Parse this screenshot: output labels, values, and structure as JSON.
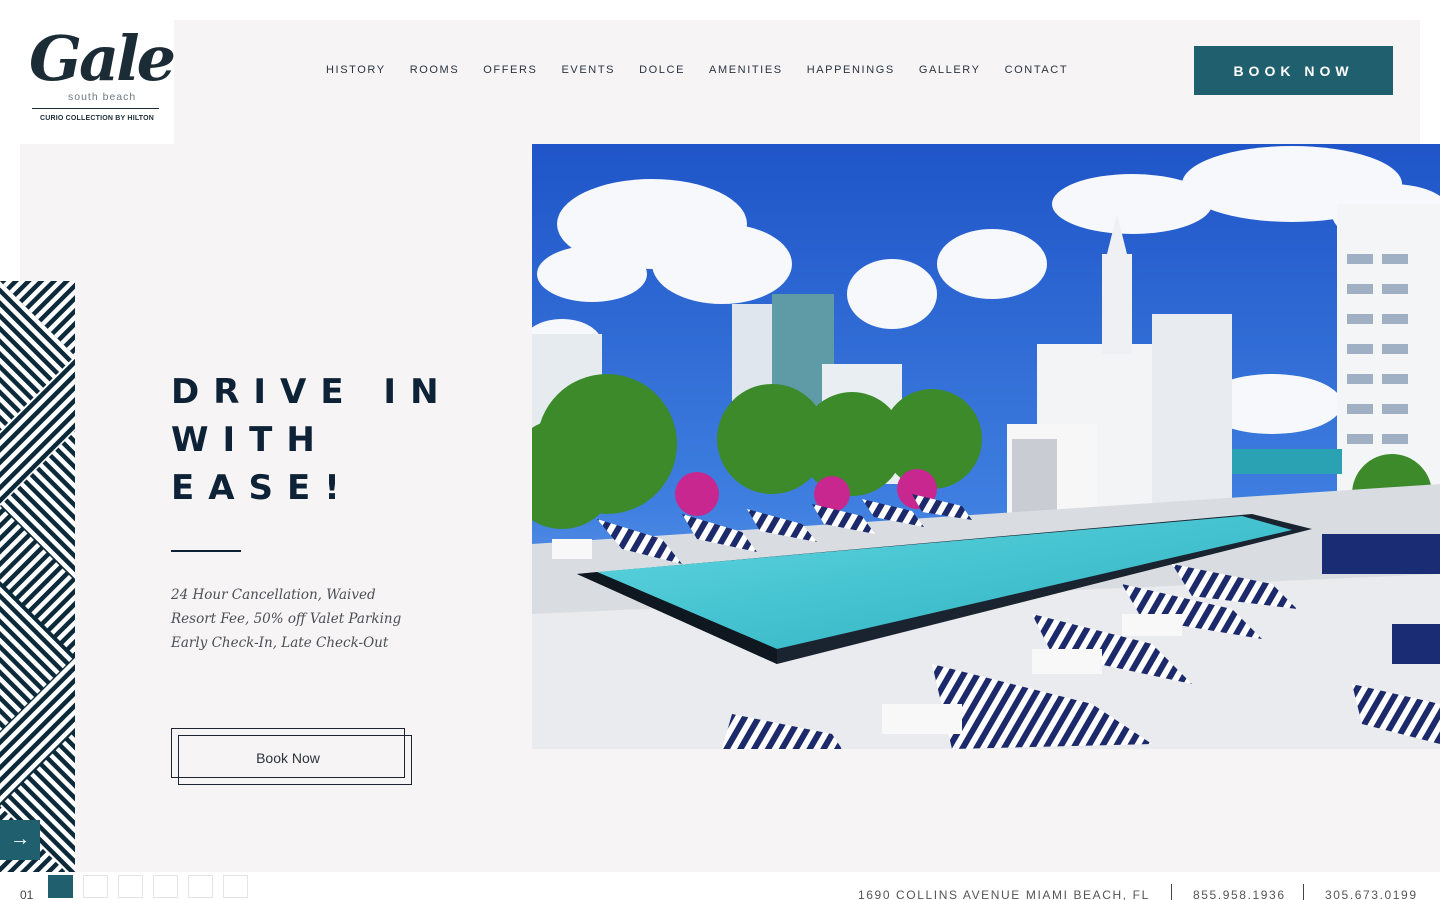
{
  "brand": {
    "logo_script": "Gale",
    "logo_sub": "south beach",
    "logo_collection": "CURIO COLLECTION BY HILTON"
  },
  "nav": {
    "items": [
      "HISTORY",
      "ROOMS",
      "OFFERS",
      "EVENTS",
      "DOLCE",
      "AMENITIES",
      "HAPPENINGS",
      "GALLERY",
      "CONTACT"
    ],
    "book_label": "BOOK NOW"
  },
  "hero": {
    "headline_lines": [
      "DRIVE IN",
      "WITH",
      "EASE!"
    ],
    "copy_lines": [
      "24 Hour Cancellation, Waived",
      "Resort Fee, 50% off Valet Parking",
      "Early Check-In, Late Check-Out"
    ],
    "cta_label": "Book Now",
    "next_arrow": "→",
    "image_icon": "rooftop-pool-photo"
  },
  "pager": {
    "current": "01",
    "total_slides": 6,
    "active_index": 0
  },
  "footer": {
    "address": "1690 COLLINS AVENUE MIAMI BEACH, FL",
    "phone_1": "855.958.1936",
    "phone_2": "305.673.0199"
  },
  "colors": {
    "accent": "#1f5f6e",
    "navy": "#0d2236",
    "panel": "#f6f4f4"
  }
}
